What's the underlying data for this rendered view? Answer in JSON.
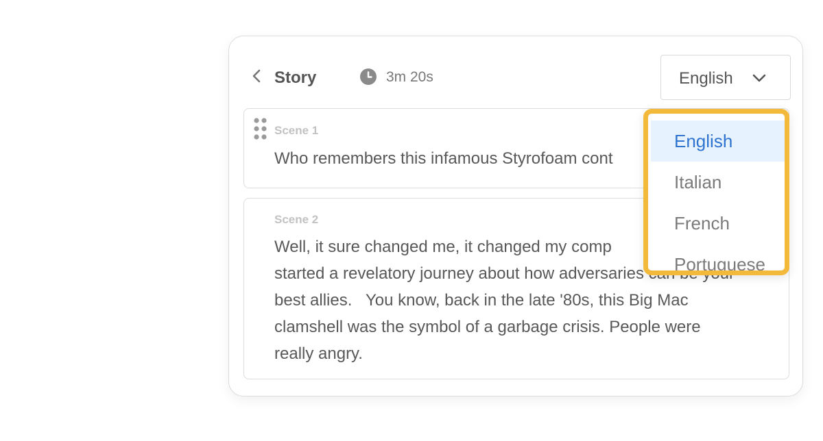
{
  "header": {
    "title": "Story",
    "duration": "3m 20s",
    "icons": {
      "back": "chevron-left-icon",
      "clock": "clock-icon"
    }
  },
  "language_select": {
    "value": "English",
    "options": [
      "English",
      "Italian",
      "French",
      "Portuguese"
    ],
    "selected_index": 0
  },
  "scenes": [
    {
      "label": "Scene 1",
      "text": "Who remembers this infamous Styrofoam cont"
    },
    {
      "label": "Scene 2",
      "text": "Well, it sure changed me, it changed my comp\nstarted a revelatory journey about how adversaries can be your\nbest allies.   You know, back in the late '80s, this Big Mac\nclamshell was the symbol of a garbage crisis. People were\nreally angry."
    }
  ],
  "colors": {
    "highlight_border": "#f3b93b",
    "selected_text": "#2f74d0",
    "selected_bg": "#e6f2fd"
  }
}
